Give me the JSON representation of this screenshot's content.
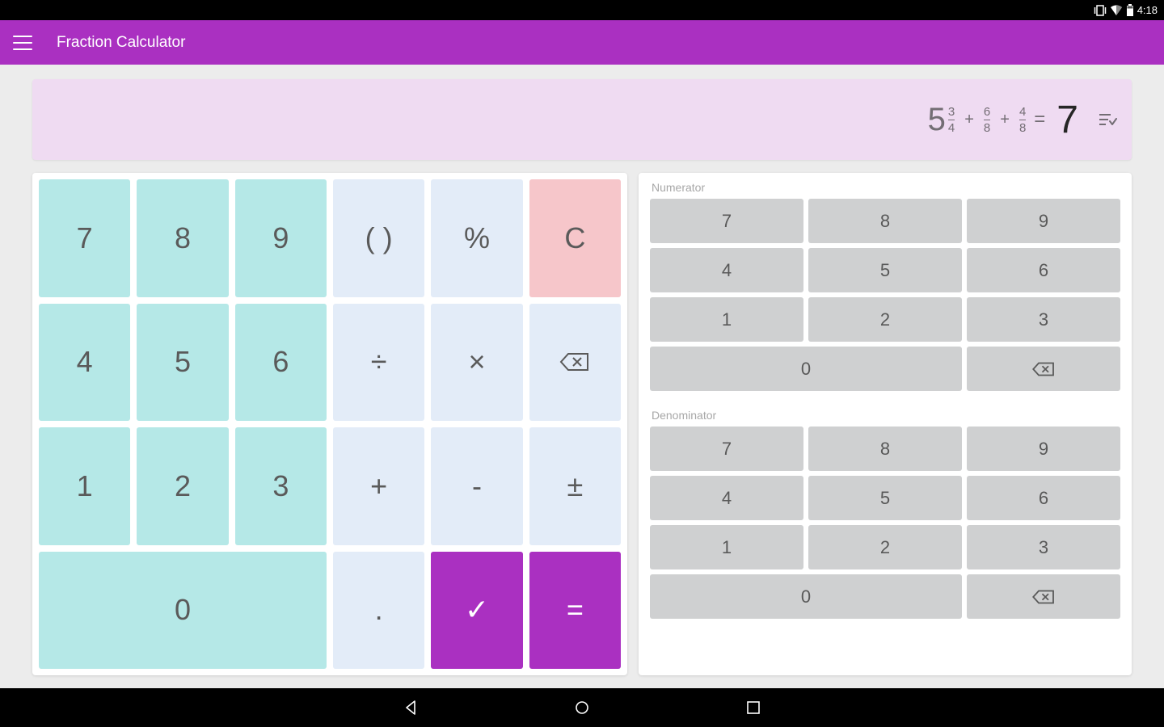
{
  "status": {
    "time": "4:18"
  },
  "app": {
    "title": "Fraction Calculator"
  },
  "display": {
    "terms": [
      {
        "whole": "5",
        "num": "3",
        "den": "4"
      },
      {
        "num": "6",
        "den": "8"
      },
      {
        "num": "4",
        "den": "8"
      }
    ],
    "op": "+",
    "equals": "=",
    "result": "7"
  },
  "keypad": {
    "main": {
      "seven": "7",
      "eight": "8",
      "nine": "9",
      "paren": "( )",
      "percent": "%",
      "clear": "C",
      "four": "4",
      "five": "5",
      "six": "6",
      "divide": "÷",
      "multiply": "×",
      "one": "1",
      "two": "2",
      "three": "3",
      "plus": "+",
      "minus": "-",
      "plusminus": "±",
      "zero": "0",
      "dot": ".",
      "check": "✓",
      "equals": "="
    },
    "side": {
      "numerator_label": "Numerator",
      "denominator_label": "Denominator",
      "seven": "7",
      "eight": "8",
      "nine": "9",
      "four": "4",
      "five": "5",
      "six": "6",
      "one": "1",
      "two": "2",
      "three": "3",
      "zero": "0"
    }
  }
}
